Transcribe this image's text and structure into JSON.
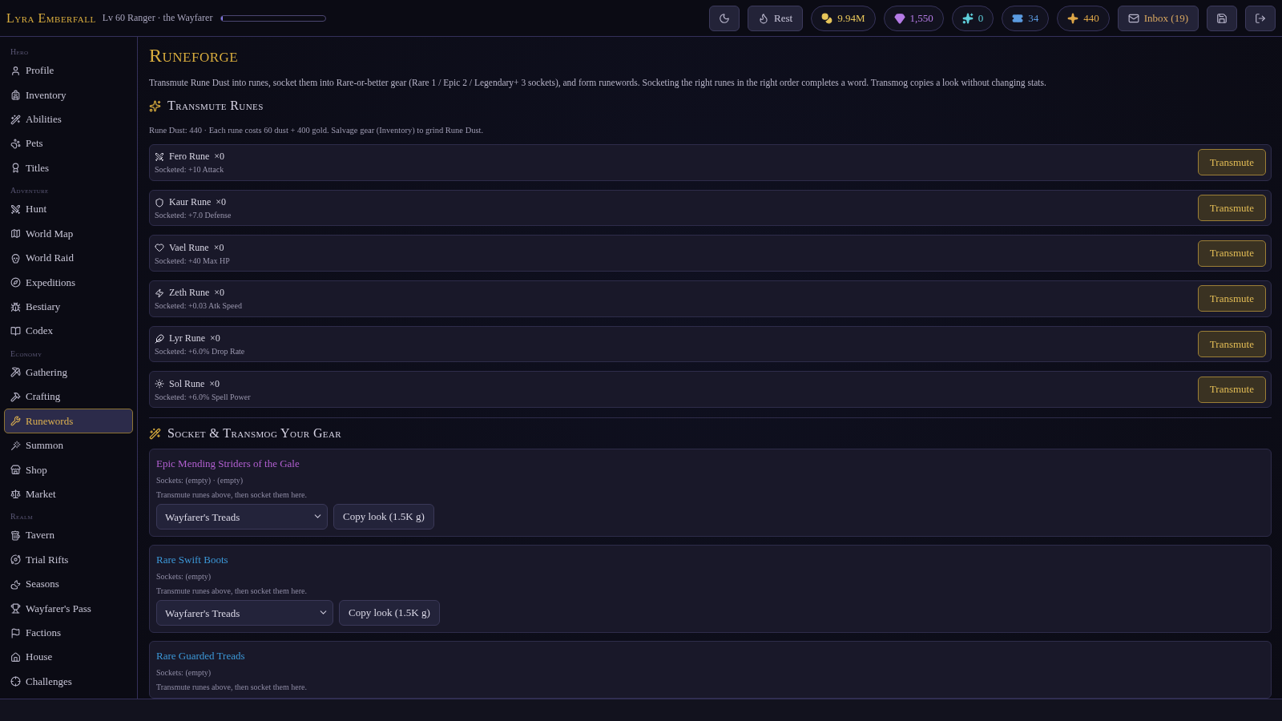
{
  "header": {
    "hero_name": "Lyra Emberfall",
    "subtitle": "Lv 60 Ranger · the Wayfarer",
    "xp": {
      "level": 0.01
    }
  },
  "toolbar": [
    {
      "kind": "icon"
    },
    {
      "kind": "button",
      "label": "Rest"
    },
    {
      "kind": "currency",
      "label": "9.94M",
      "color": "#e8c65a"
    },
    {
      "kind": "currency",
      "label": "1,550",
      "color": "#b57be6"
    },
    {
      "kind": "currency",
      "label": "0",
      "color": "#5fd0dc"
    },
    {
      "kind": "currency",
      "label": "34",
      "color": "#5b9be0"
    },
    {
      "kind": "currency",
      "label": "440",
      "color": "#e0a848"
    },
    {
      "kind": "button",
      "label": "Inbox (19)"
    },
    {
      "kind": "icon"
    },
    {
      "kind": "icon"
    }
  ],
  "sidebar": {
    "sections": [
      {
        "title": "Hero",
        "items": [
          {
            "label": "Profile",
            "selected": false
          },
          {
            "label": "Inventory",
            "selected": false
          },
          {
            "label": "Abilities",
            "selected": false
          },
          {
            "label": "Pets",
            "selected": false
          },
          {
            "label": "Titles",
            "selected": false
          }
        ]
      },
      {
        "title": "Adventure",
        "items": [
          {
            "label": "Hunt",
            "selected": false
          },
          {
            "label": "World Map",
            "selected": false
          },
          {
            "label": "World Raid",
            "selected": false
          },
          {
            "label": "Expeditions",
            "selected": false
          },
          {
            "label": "Bestiary",
            "selected": false
          },
          {
            "label": "Codex",
            "selected": false
          }
        ]
      },
      {
        "title": "Economy",
        "items": [
          {
            "label": "Gathering",
            "selected": false
          },
          {
            "label": "Crafting",
            "selected": false
          },
          {
            "label": "Runewords",
            "selected": true
          },
          {
            "label": "Summon",
            "selected": false
          },
          {
            "label": "Shop",
            "selected": false
          },
          {
            "label": "Market",
            "selected": false
          }
        ]
      },
      {
        "title": "Realm",
        "items": [
          {
            "label": "Tavern",
            "selected": false
          },
          {
            "label": "Trial Rifts",
            "selected": false
          },
          {
            "label": "Seasons",
            "selected": false
          },
          {
            "label": "Wayfarer's Pass",
            "selected": false
          },
          {
            "label": "Factions",
            "selected": false
          },
          {
            "label": "House",
            "selected": false
          },
          {
            "label": "Challenges",
            "selected": false
          }
        ]
      }
    ]
  },
  "page": {
    "title": "Runeforge",
    "intro": "Transmute Rune Dust into runes, socket them into Rare-or-better gear (Rare 1 / Epic 2 / Legendary+ 3 sockets), and form runewords. Socketing the right runes in the right order completes a word. Transmog copies a look without changing stats."
  },
  "transmute": {
    "title": "Transmute Runes",
    "note": "Rune Dust: 440 · Each rune costs 60 dust + 400 gold. Salvage gear (Inventory) to grind Rune Dust.",
    "runes": [
      {
        "name": "Fero Rune",
        "count": "×0",
        "effect": "Socketed: +10 Attack",
        "button": "Transmute"
      },
      {
        "name": "Kaur Rune",
        "count": "×0",
        "effect": "Socketed: +7.0 Defense",
        "button": "Transmute"
      },
      {
        "name": "Vael Rune",
        "count": "×0",
        "effect": "Socketed: +40 Max HP",
        "button": "Transmute"
      },
      {
        "name": "Zeth Rune",
        "count": "×0",
        "effect": "Socketed: +0.03 Atk Speed",
        "button": "Transmute"
      },
      {
        "name": "Lyr Rune",
        "count": "×0",
        "effect": "Socketed: +6.0% Drop Rate",
        "button": "Transmute"
      },
      {
        "name": "Sol Rune",
        "count": "×0",
        "effect": "Socketed: +6.0% Spell Power",
        "button": "Transmute"
      }
    ]
  },
  "gear": {
    "title": "Socket & Transmog Your Gear",
    "items": [
      {
        "name": "Epic Mending Striders of the Gale",
        "color": "#b15fd0",
        "sockets": "Sockets: (empty) · (empty)",
        "hint": "Transmute runes above, then socket them here.",
        "look": "Wayfarer's Treads",
        "copy_button": "Copy look (1.5K g)"
      },
      {
        "name": "Rare Swift Boots",
        "color": "#3c98d8",
        "sockets": "Sockets: (empty)",
        "hint": "Transmute runes above, then socket them here.",
        "look": "Wayfarer's Treads",
        "copy_button": "Copy look (1.5K g)"
      },
      {
        "name": "Rare Guarded Treads",
        "color": "#3c98d8",
        "sockets": "Sockets: (empty)",
        "hint": "Transmute runes above, then socket them here."
      }
    ]
  }
}
